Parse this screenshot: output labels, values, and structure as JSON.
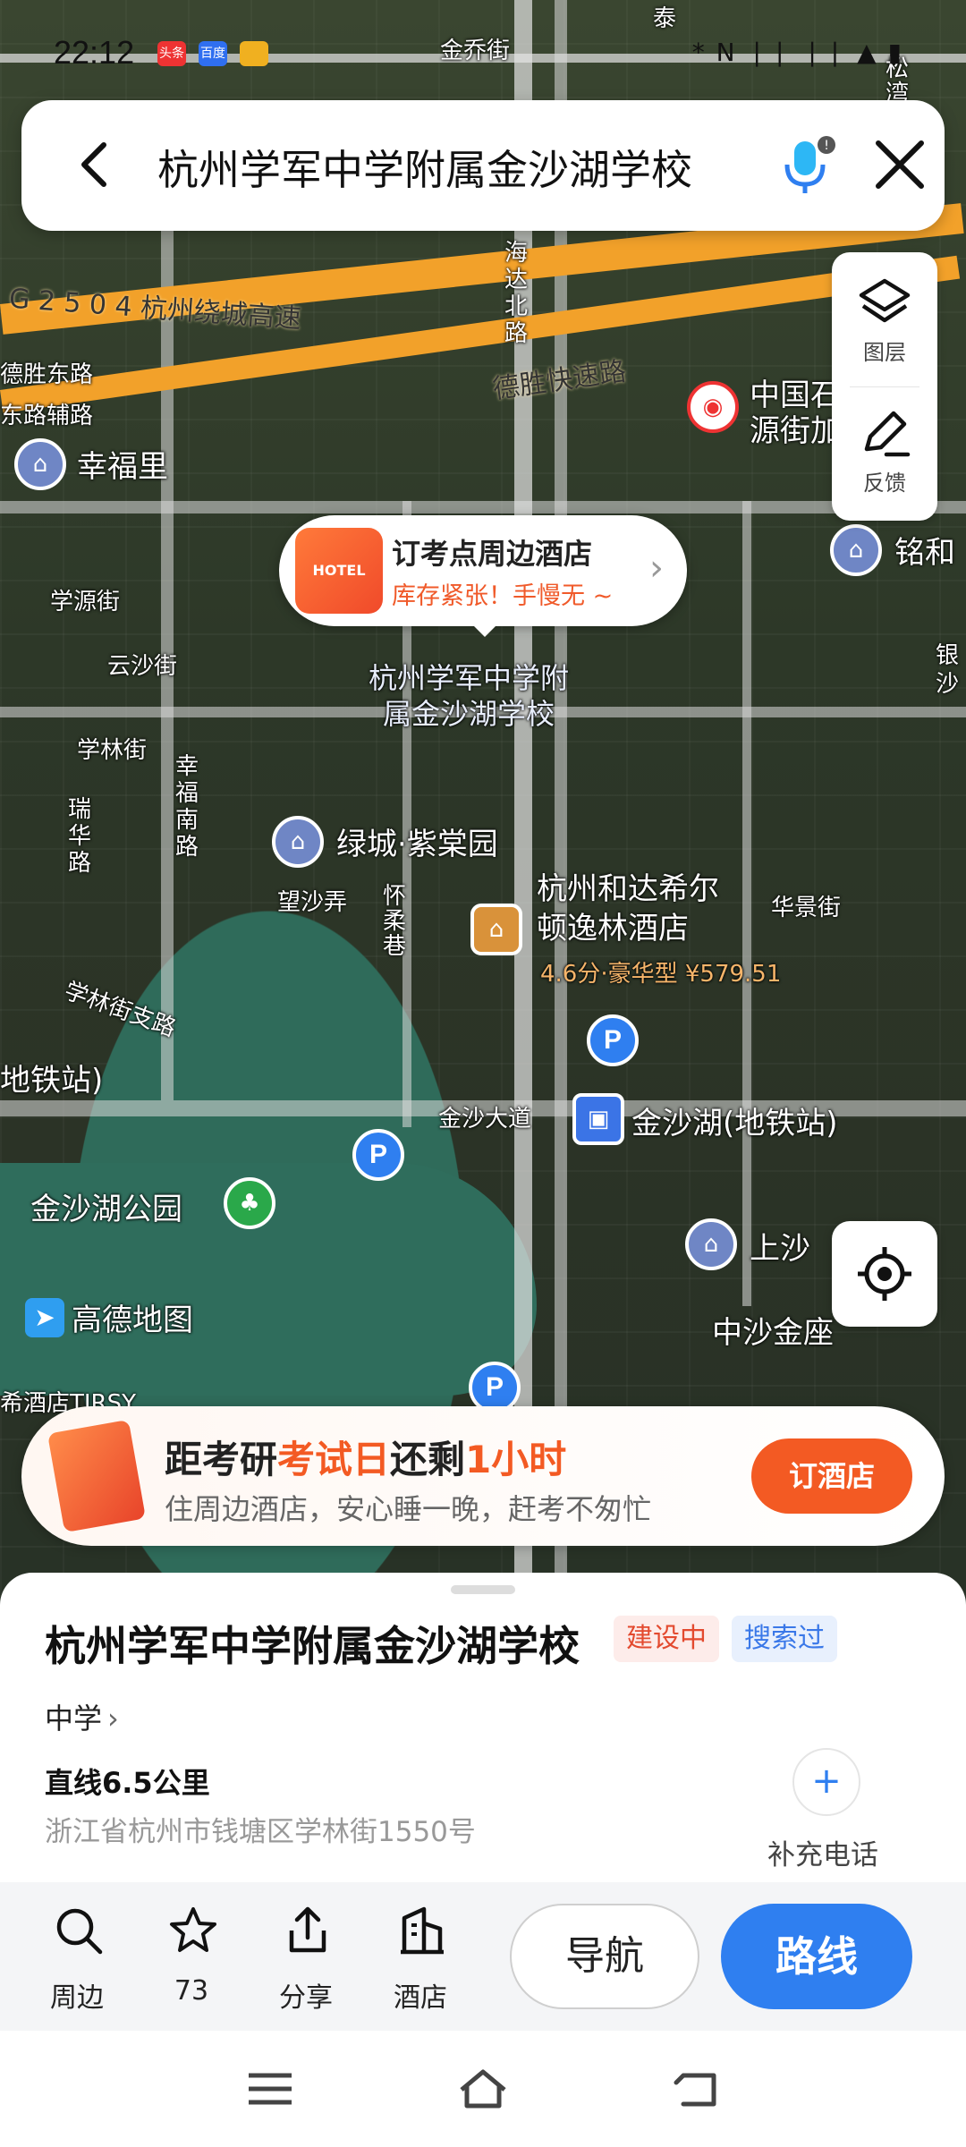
{
  "status_bar": {
    "time": "22:12",
    "app_badges": [
      "头条",
      "百度"
    ],
    "system_icons": "* N ❘❘ ❘❘ ▲ ▮"
  },
  "search": {
    "query": "杭州学军中学附属金沙湖学校"
  },
  "tools": {
    "layers_label": "图层",
    "feedback_label": "反馈"
  },
  "map": {
    "labels": {
      "jinqiao_street": "金乔街",
      "tai": "泰",
      "song": "松",
      "wan": "湾",
      "g2504": "G 2 5 0 4 杭州绕城高速",
      "haida_north_road": "海\n达\n北\n路",
      "desheng_expressway": "德胜快速路",
      "desheng_east_road": "德胜东路",
      "fu_road": "东路辅路",
      "xingfuli": "幸福里",
      "china_sinopec": "中国石",
      "yuan_street": "源街加",
      "minghe": "铭和",
      "xueyuan_street": "学源街",
      "yunsha_street": "云沙街",
      "school_name_map": "杭州学军中学附\n属金沙湖学校",
      "yin": "银",
      "sha": "沙",
      "xuelin_street": "学林街",
      "xingfu_south_road": "幸\n福\n南\n路",
      "ruihua_road": "瑞\n华\n路",
      "lvcheng_zitangyuan": "绿城·紫棠园",
      "hilton": "杭州和达希尔\n顿逸林酒店",
      "hilton_price": "4.6分·豪华型 ¥579.51",
      "huajing_street": "华景街",
      "wangsha_lane": "望沙弄",
      "huairou_lane": "怀\n柔\n巷",
      "xuelin_branch_road": "学林街支路",
      "metro_station_left": "地铁站)",
      "jinsha_avenue": "金沙大道",
      "jinshahu_metro": "金沙湖(地铁站)",
      "jinshahu_park": "金沙湖公园",
      "shangsha": "上沙",
      "zhongsha_jinzuo": "中沙金座",
      "amap_logo": "高德地图",
      "hotel_fragment": "希酒店TIRSY"
    },
    "pin_icons": [
      "home-icon",
      "hotel-icon",
      "parking-icon",
      "metro-icon",
      "park-icon"
    ]
  },
  "hotel_bubble": {
    "image_text": "HOTEL",
    "title": "订考点周边酒店",
    "subtitle": "库存紧张！手慢无 ~"
  },
  "exam_banner": {
    "prefix": "距考研",
    "highlight1": "考试日",
    "middle": "还剩",
    "highlight2": "1小时",
    "subtitle": "住周边酒店，安心睡一晚，赶考不匆忙",
    "button": "订酒店"
  },
  "place": {
    "name": "杭州学军中学附属金沙湖学校",
    "tag_building": "建设中",
    "tag_searched": "搜索过",
    "category": "中学",
    "distance": "直线6.5公里",
    "address": "浙江省杭州市钱塘区学林街1550号",
    "add_phone_label": "补充电话"
  },
  "actions": {
    "nearby": "周边",
    "favorite_count": "73",
    "share": "分享",
    "hotel": "酒店",
    "navigate": "导航",
    "route": "路线"
  },
  "colors": {
    "accent_blue": "#2f7ff0",
    "accent_orange": "#f35a23",
    "expressway": "#f2a12a"
  }
}
